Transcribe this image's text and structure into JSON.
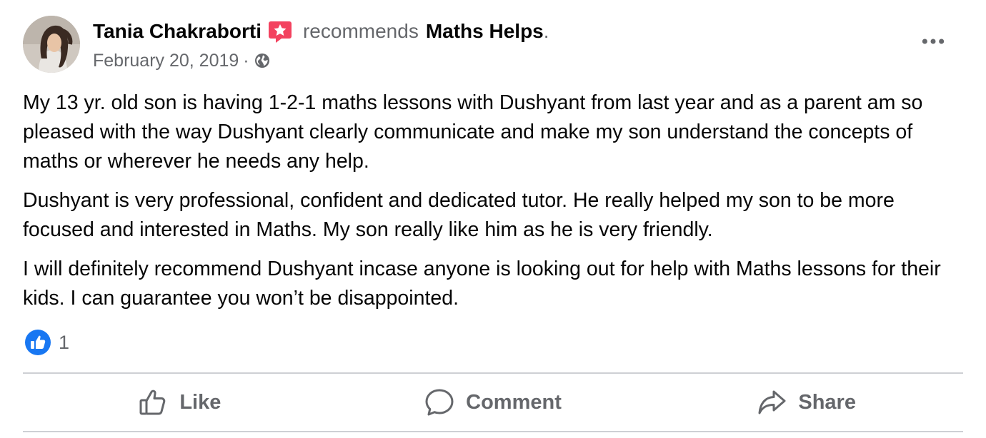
{
  "post": {
    "author": {
      "name": "Tania Chakraborti",
      "badge_icon": "recommendation-star-icon"
    },
    "action_text": "recommends",
    "page_name": "Maths Helps",
    "page_name_suffix": ".",
    "date": "February 20, 2019",
    "meta_separator": "·",
    "privacy_icon": "globe-icon",
    "more_icon": "more-horizontal-icon",
    "paragraphs": [
      "My 13 yr. old son is having 1-2-1 maths lessons with Dushyant from last year and as a parent am so pleased with the way Dushyant clearly communicate and make my son understand the concepts of maths or wherever he needs any help.",
      "Dushyant is very professional, confident and dedicated tutor. He really helped my son to be more focused and interested in Maths. My son really like him as he is very friendly.",
      "I will definitely recommend Dushyant incase anyone is looking out for help with Maths lessons for their kids. I can guarantee you won’t be disappointed."
    ],
    "reactions": {
      "icon": "like-reaction-icon",
      "count": "1"
    },
    "actions": {
      "like": "Like",
      "comment": "Comment",
      "share": "Share"
    },
    "colors": {
      "text": "#050505",
      "muted": "#65676b",
      "like_blue": "#1877f2",
      "badge_red": "#f3425f",
      "divider": "#ced0d4"
    }
  }
}
